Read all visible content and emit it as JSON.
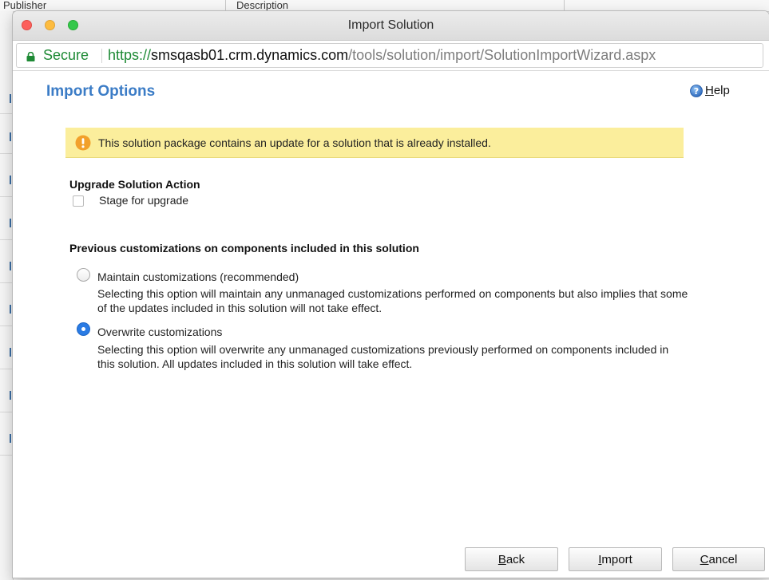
{
  "background": {
    "columns": [
      "Publisher",
      "Description"
    ]
  },
  "window": {
    "title": "Import Solution"
  },
  "address_bar": {
    "secure_label": "Secure",
    "url_scheme": "https://",
    "url_host": "smsqasb01.crm.dynamics.com",
    "url_path": "/tools/solution/import/SolutionImportWizard.aspx"
  },
  "dialog": {
    "title": "Import Options",
    "help": {
      "accel": "H",
      "rest": "elp",
      "icon": "help-icon"
    },
    "notice": {
      "icon": "warning-icon",
      "text": "This solution package contains an update for a solution that is already installed."
    },
    "upgrade_section": {
      "heading": "Upgrade Solution Action",
      "checkbox_label": "Stage for upgrade",
      "checked": false
    },
    "customizations_section": {
      "heading": "Previous customizations on components included in this solution",
      "options": [
        {
          "label": "Maintain customizations (recommended)",
          "description": "Selecting this option will maintain any unmanaged customizations performed on components but also implies that some of the updates included in this solution will not take effect.",
          "selected": false
        },
        {
          "label": "Overwrite customizations",
          "description": "Selecting this option will overwrite any unmanaged customizations previously performed on components included in this solution. All updates included in this solution will take effect.",
          "selected": true
        }
      ]
    },
    "buttons": {
      "back": {
        "accel": "B",
        "rest": "ack"
      },
      "import": {
        "accel": "I",
        "rest": "mport"
      },
      "cancel": {
        "accel": "C",
        "rest": "ancel"
      }
    }
  },
  "colors": {
    "title_blue": "#3b7cc6",
    "secure_green": "#1e8a35",
    "notice_yellow": "#fbee9c",
    "radio_selected": "#2a7be4"
  }
}
